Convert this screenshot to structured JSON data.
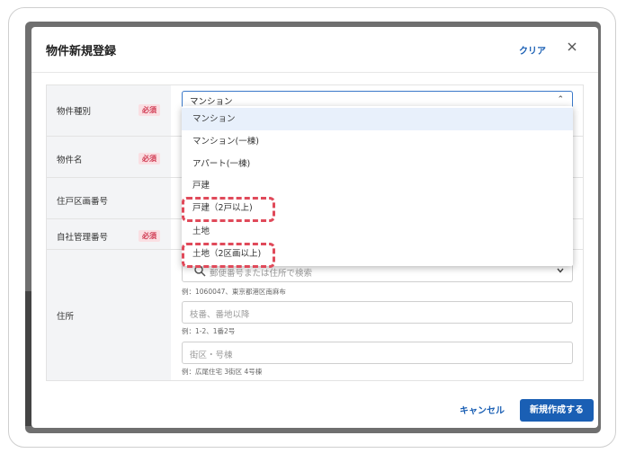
{
  "dialog": {
    "title": "物件新規登録",
    "clear_label": "クリア",
    "close_icon": "close-icon"
  },
  "form": {
    "required_badge": "必須",
    "fields": {
      "type_label": "物件種別",
      "name_label": "物件名",
      "unit_label": "住戸区画番号",
      "internal_label": "自社管理番号",
      "address_label": "住所"
    },
    "property_type": {
      "value": "マンション",
      "options": [
        "マンション",
        "マンション(一棟)",
        "アパート(一棟)",
        "戸建",
        "戸建（2戸以上)",
        "土地",
        "土地（2区画以上)"
      ]
    },
    "address": {
      "search_placeholder": "郵便番号または住所で検索",
      "search_hint": "例：1060047、東京都港区南麻布",
      "street_placeholder": "枝番、番地以降",
      "street_hint": "例：1-2、1番2号",
      "building_placeholder": "街区・号棟",
      "building_hint": "例：広尾住宅 3街区 4号棟"
    }
  },
  "footer": {
    "cancel_label": "キャンセル",
    "submit_label": "新規作成する"
  },
  "colors": {
    "accent": "#1a5fb4",
    "required": "#d03a52",
    "highlight": "#e04a5a"
  }
}
